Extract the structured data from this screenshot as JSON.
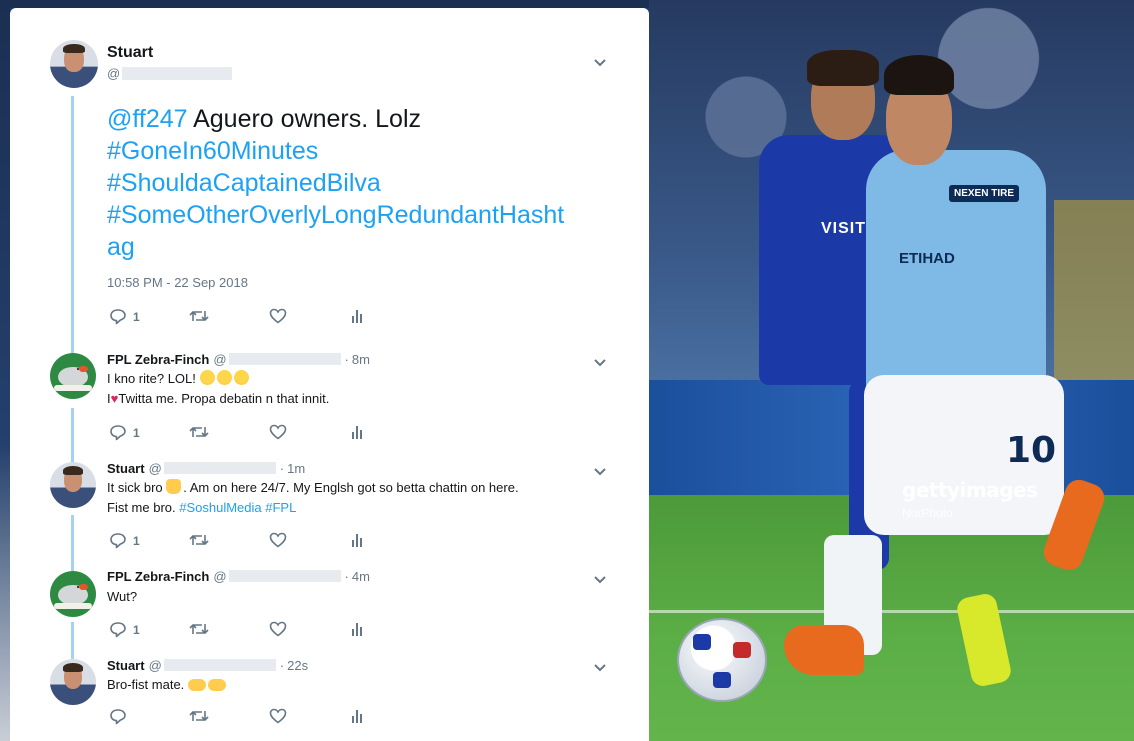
{
  "photo": {
    "watermark_brand": "gettyimages",
    "watermark_credit": "NurPhoto",
    "shirt_text_blue": "VISIT",
    "shirt_sponsor_sky": "ETIHAD",
    "sleeve_badge": "NEXEN TIRE",
    "shirt_number": "10"
  },
  "main_tweet": {
    "name": "Stuart",
    "handle_prefix": "@",
    "lines": [
      {
        "mention": "@ff247",
        "text": " Aguero owners. Lolz"
      },
      {
        "hashtag": "#GoneIn60Minutes"
      },
      {
        "hashtag": "#ShouldaCaptainedBilva"
      },
      {
        "hashtag": "#SomeOtherOverlyLongRedundantHasht"
      },
      {
        "hashtag": "ag"
      }
    ],
    "timestamp": "10:58 PM - 22 Sep 2018",
    "reply_count": "1"
  },
  "replies": [
    {
      "name": "FPL Zebra-Finch",
      "handle_prefix": "@",
      "time": "8m",
      "line1": "I kno rite? LOL! ",
      "line2_pre": "I",
      "line2_post": "Twitta me. Propa debatin n that innit.",
      "reply_count": "1"
    },
    {
      "name": "Stuart",
      "handle_prefix": "@",
      "time": "1m",
      "line1_pre": "It sick bro ",
      "line1_post": ".  Am on here 24/7. My Englsh got so betta chattin on here.",
      "line2_pre": "Fist me bro. ",
      "hashtag1": "#SoshulMedia",
      "hashtag2": "#FPL",
      "reply_count": "1"
    },
    {
      "name": "FPL Zebra-Finch",
      "handle_prefix": "@",
      "time": "4m",
      "line1": "Wut?",
      "reply_count": "1"
    },
    {
      "name": "Stuart",
      "handle_prefix": "@",
      "time": "22s",
      "line1": "Bro-fist mate. ",
      "reply_count": ""
    }
  ],
  "colors": {
    "link": "#1da1f2",
    "thread_line": "#a5d2f2",
    "muted": "#657786"
  }
}
